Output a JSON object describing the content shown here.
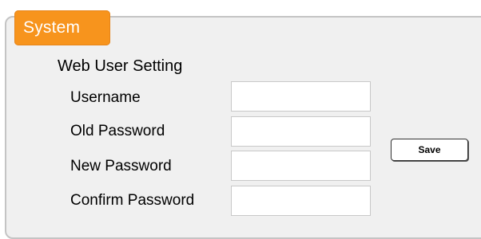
{
  "tab": {
    "label": "System",
    "color": "#f7941d"
  },
  "section": {
    "title": "Web User Setting"
  },
  "fields": {
    "username": {
      "label": "Username",
      "value": ""
    },
    "old_password": {
      "label": "Old Password",
      "value": ""
    },
    "new_password": {
      "label": "New Password",
      "value": ""
    },
    "confirm_password": {
      "label": "Confirm Password",
      "value": ""
    }
  },
  "actions": {
    "save_label": "Save"
  }
}
